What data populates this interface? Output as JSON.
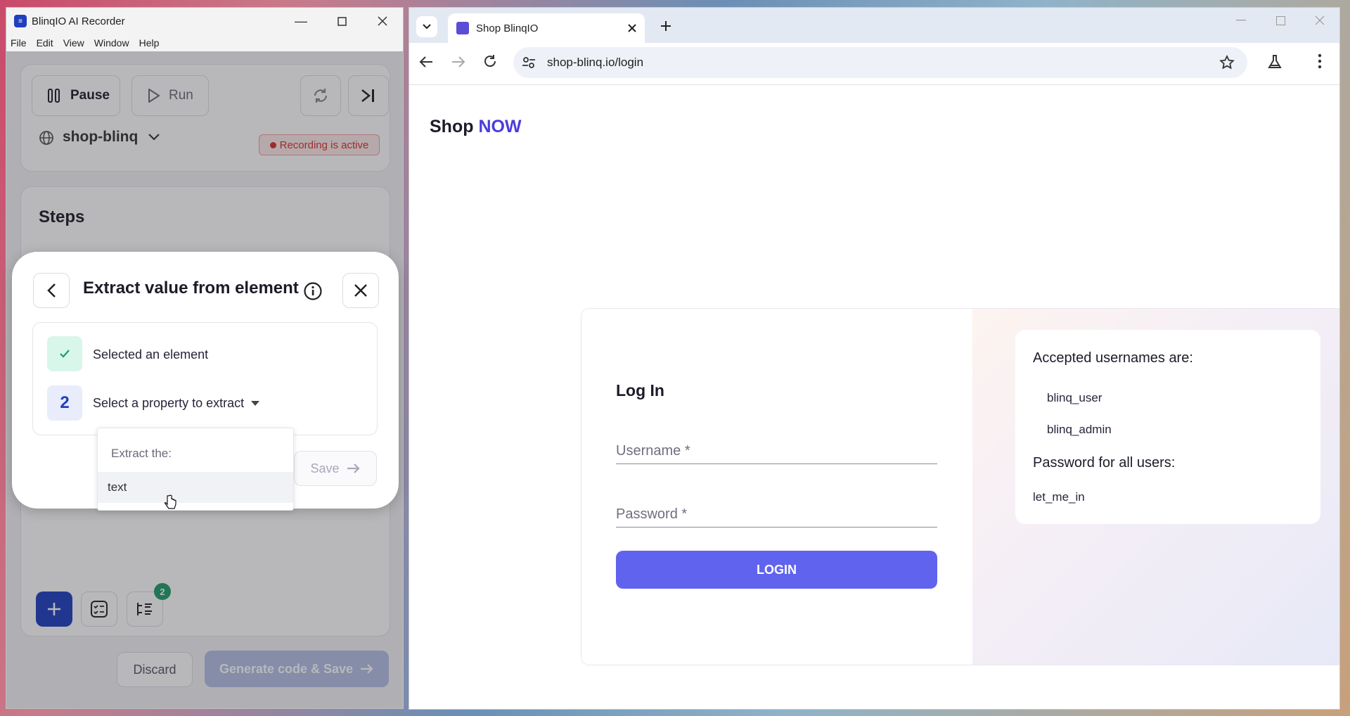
{
  "recorder": {
    "title": "BlinqIO AI Recorder",
    "menu": [
      "File",
      "Edit",
      "View",
      "Window",
      "Help"
    ],
    "pause_label": "Pause",
    "run_label": "Run",
    "project": "shop-blinq",
    "recording_status": "Recording is active",
    "steps_title": "Steps",
    "badge_count": "2",
    "discard_label": "Discard",
    "generate_label": "Generate code & Save"
  },
  "modal": {
    "title": "Extract value from element",
    "step1_label": "Selected an element",
    "step2_number": "2",
    "step2_label": "Select a property to extract",
    "save_label": "Save",
    "dropdown_header": "Extract the:",
    "dropdown_options": [
      "text"
    ]
  },
  "browser": {
    "tab_title": "Shop BlinqIO",
    "url": "shop-blinq.io/login"
  },
  "page": {
    "brand_prefix": "Shop",
    "brand_highlight": "NOW",
    "login_heading": "Log In",
    "username_placeholder": "Username *",
    "password_placeholder": "Password *",
    "login_button": "LOGIN",
    "accepted_title": "Accepted usernames are:",
    "usernames": [
      "blinq_user",
      "blinq_admin"
    ],
    "password_title": "Password for all users:",
    "password_value": "let_me_in"
  },
  "colors": {
    "accent": "#6063ee",
    "brand_highlight": "#4b3cde",
    "recording": "#d6302a",
    "primary_dark": "#1f3fbf"
  }
}
